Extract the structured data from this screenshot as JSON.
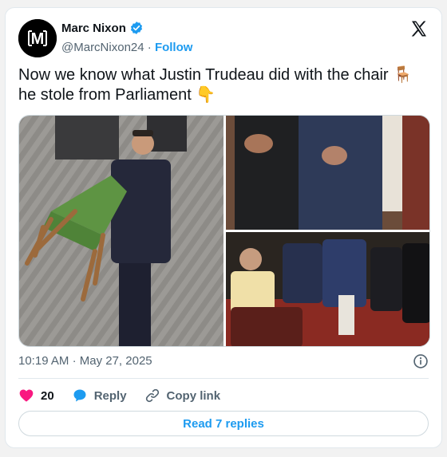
{
  "author": {
    "name": "Marc Nixon",
    "handle": "@MarcNixon24",
    "separator": "·",
    "follow_label": "Follow",
    "avatar_letter": "M"
  },
  "tweet": {
    "text_line1": "Now we know what Justin Trudeau did with the chair 🪑",
    "text_line2": "he stole from Parliament 👇"
  },
  "meta": {
    "time": "10:19 AM",
    "separator": "·",
    "date": "May 27, 2025"
  },
  "actions": {
    "like_count": "20",
    "reply_label": "Reply",
    "copy_link_label": "Copy link"
  },
  "read_replies_label": "Read 7 replies",
  "colors": {
    "accent": "#1d9bf0",
    "like": "#f91880",
    "muted": "#536471",
    "text": "#0f1419"
  },
  "icons": [
    "verified-badge-icon",
    "x-logo-icon",
    "info-icon",
    "heart-icon",
    "reply-bubble-icon",
    "link-icon"
  ]
}
